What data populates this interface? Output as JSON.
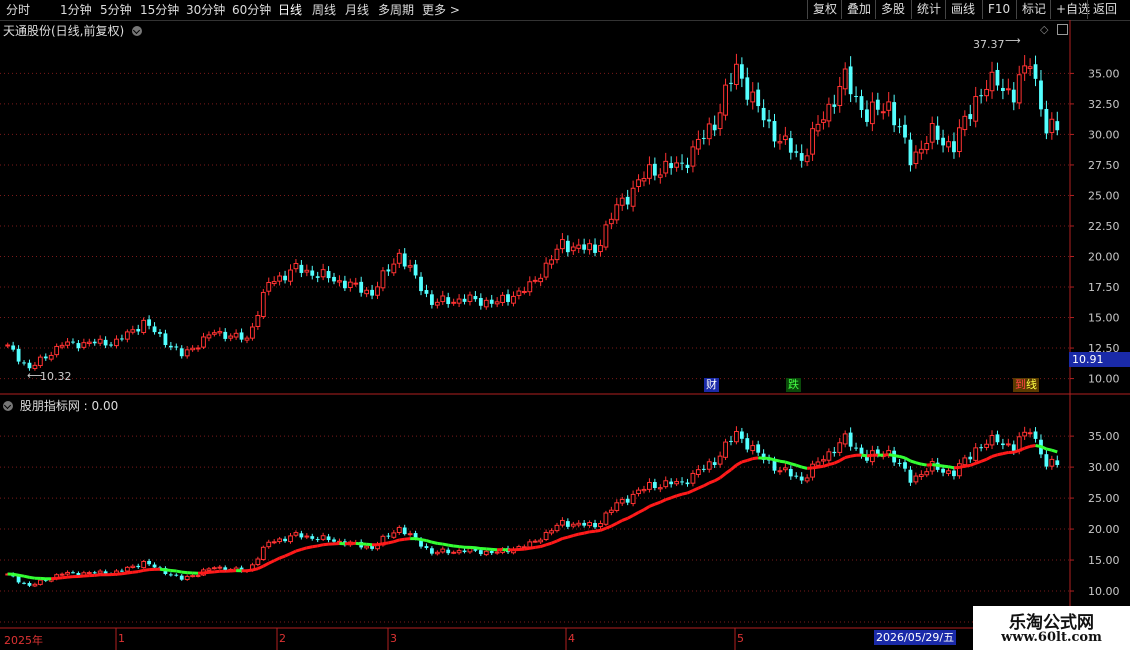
{
  "toolbar": {
    "left": [
      "分时",
      "1分钟",
      "5分钟",
      "15分钟",
      "30分钟",
      "60分钟",
      "日线",
      "周线",
      "月线",
      "多周期",
      "更多 >"
    ],
    "active": "日线",
    "right": [
      "复权",
      "叠加",
      "多股",
      "统计",
      "画线",
      "F10",
      "标记",
      "+自选",
      "返回"
    ]
  },
  "main_title": "天通股份(日线,前复权)",
  "indicator_title": "股朋指标网 : 0.00",
  "annotations": {
    "high": "37.37",
    "low": "10.32",
    "current_price": "10.91"
  },
  "badges": {
    "cai": "财",
    "die": "跌",
    "wen": "到",
    "lan": "线"
  },
  "x_axis": {
    "year": "2025年",
    "months": [
      "1",
      "2",
      "3",
      "4",
      "5"
    ],
    "cursor_date": "2026/05/29/五"
  },
  "watermark": {
    "line1": "乐淘公式网",
    "line2": "www.60lt.com"
  },
  "colors": {
    "up": "#ff3232",
    "down": "#54ffff",
    "grid": "#7a1a1a",
    "axis": "#b02020",
    "highlight": "#1a2aa8"
  },
  "chart_data": {
    "type": "candlestick",
    "main_axis_ticks": [
      "35.00",
      "32.50",
      "30.00",
      "27.50",
      "25.00",
      "22.50",
      "20.00",
      "17.50",
      "15.00",
      "12.50",
      "10.00"
    ],
    "indicator_axis_ticks": [
      "35.00",
      "30.00",
      "25.00",
      "20.00",
      "15.00",
      "10.00",
      "5.00"
    ],
    "main_ylim": [
      8.9,
      37.9
    ],
    "indicator_ylim": [
      5.0,
      39.7
    ],
    "price_anchors": [
      {
        "day": 0,
        "close": 12.6
      },
      {
        "day": 4,
        "close": 10.8
      },
      {
        "day": 10,
        "close": 12.8
      },
      {
        "day": 20,
        "close": 13.0
      },
      {
        "day": 25,
        "close": 14.6
      },
      {
        "day": 32,
        "close": 11.9
      },
      {
        "day": 38,
        "close": 13.8
      },
      {
        "day": 44,
        "close": 13.2
      },
      {
        "day": 48,
        "close": 17.8
      },
      {
        "day": 53,
        "close": 19.0
      },
      {
        "day": 58,
        "close": 18.4
      },
      {
        "day": 62,
        "close": 17.8
      },
      {
        "day": 67,
        "close": 17.0
      },
      {
        "day": 72,
        "close": 20.2
      },
      {
        "day": 78,
        "close": 16.2
      },
      {
        "day": 84,
        "close": 16.5
      },
      {
        "day": 90,
        "close": 16.2
      },
      {
        "day": 96,
        "close": 17.5
      },
      {
        "day": 102,
        "close": 21.0
      },
      {
        "day": 108,
        "close": 20.5
      },
      {
        "day": 112,
        "close": 24.0
      },
      {
        "day": 118,
        "close": 27.0
      },
      {
        "day": 124,
        "close": 27.5
      },
      {
        "day": 130,
        "close": 31.0
      },
      {
        "day": 134,
        "close": 35.5
      },
      {
        "day": 138,
        "close": 32.0
      },
      {
        "day": 142,
        "close": 29.5
      },
      {
        "day": 146,
        "close": 28.0
      },
      {
        "day": 150,
        "close": 31.5
      },
      {
        "day": 154,
        "close": 34.5
      },
      {
        "day": 158,
        "close": 31.5
      },
      {
        "day": 162,
        "close": 32.5
      },
      {
        "day": 166,
        "close": 28.0
      },
      {
        "day": 170,
        "close": 30.0
      },
      {
        "day": 174,
        "close": 29.0
      },
      {
        "day": 178,
        "close": 33.0
      },
      {
        "day": 182,
        "close": 34.5
      },
      {
        "day": 185,
        "close": 33.0
      },
      {
        "day": 188,
        "close": 36.5
      },
      {
        "day": 191,
        "close": 30.0
      },
      {
        "day": 193,
        "close": 31.0
      }
    ]
  }
}
